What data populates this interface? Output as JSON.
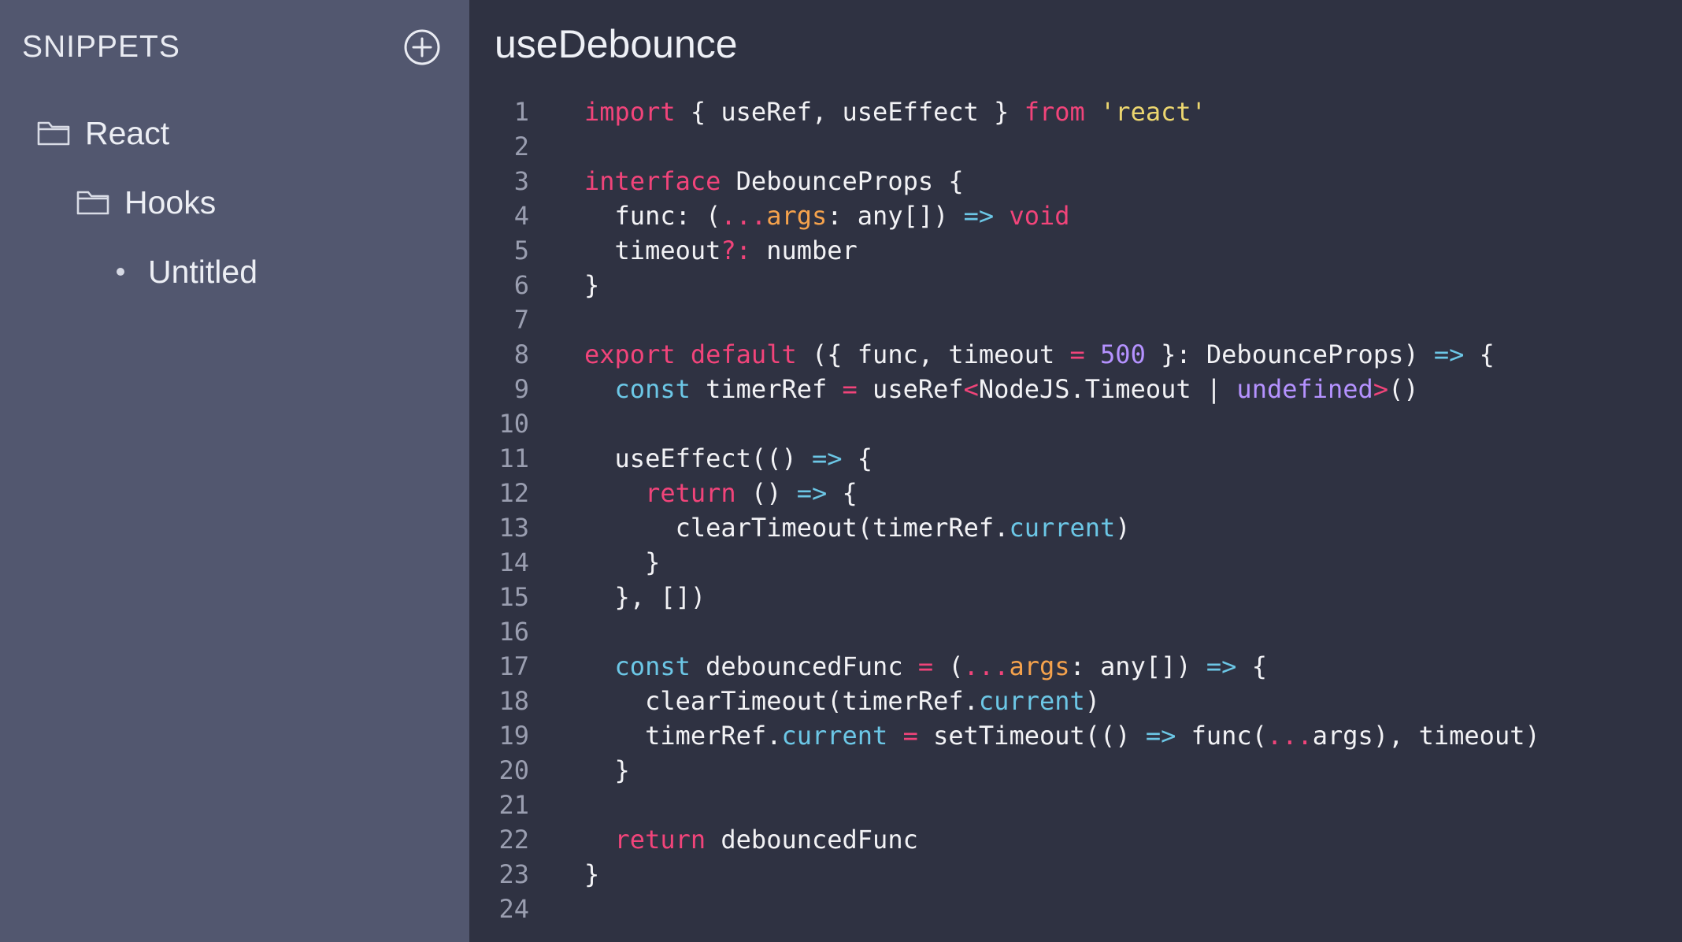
{
  "sidebar": {
    "title": "SNIPPETS",
    "add_icon": "plus-circle-icon",
    "items": [
      {
        "label": "React",
        "icon": "folder-icon",
        "level": 0
      },
      {
        "label": "Hooks",
        "icon": "folder-icon",
        "level": 1
      },
      {
        "label": "Untitled",
        "icon": "bullet-icon",
        "level": 2
      }
    ]
  },
  "editor": {
    "title": "useDebounce",
    "colors": {
      "keyword": "#f1447a",
      "string": "#ecd66f",
      "param": "#f5a24c",
      "arrow": "#6cc7e6",
      "number": "#b592ff",
      "text": "#f2f2f5",
      "line_number": "#9a9eb0"
    },
    "lines": [
      {
        "n": "1",
        "tokens": [
          [
            "kw",
            "import"
          ],
          [
            "plain",
            " { useRef, useEffect } "
          ],
          [
            "kw",
            "from"
          ],
          [
            "plain",
            " "
          ],
          [
            "str",
            "'react'"
          ]
        ]
      },
      {
        "n": "2",
        "tokens": []
      },
      {
        "n": "3",
        "tokens": [
          [
            "kw",
            "interface"
          ],
          [
            "plain",
            " DebounceProps {"
          ]
        ]
      },
      {
        "n": "4",
        "tokens": [
          [
            "plain",
            "  func: ("
          ],
          [
            "kw",
            "..."
          ],
          [
            "param",
            "args"
          ],
          [
            "plain",
            ": any[]) "
          ],
          [
            "blue",
            "=>"
          ],
          [
            "plain",
            " "
          ],
          [
            "kw",
            "void"
          ]
        ]
      },
      {
        "n": "5",
        "tokens": [
          [
            "plain",
            "  timeout"
          ],
          [
            "kw",
            "?:"
          ],
          [
            "plain",
            " number"
          ]
        ]
      },
      {
        "n": "6",
        "tokens": [
          [
            "plain",
            "}"
          ]
        ]
      },
      {
        "n": "7",
        "tokens": []
      },
      {
        "n": "8",
        "tokens": [
          [
            "kw",
            "export"
          ],
          [
            "plain",
            " "
          ],
          [
            "kw",
            "default"
          ],
          [
            "plain",
            " ({ func, timeout "
          ],
          [
            "kw",
            "="
          ],
          [
            "plain",
            " "
          ],
          [
            "num",
            "500"
          ],
          [
            "plain",
            " }: DebounceProps) "
          ],
          [
            "blue",
            "=>"
          ],
          [
            "plain",
            " {"
          ]
        ]
      },
      {
        "n": "9",
        "tokens": [
          [
            "plain",
            "  "
          ],
          [
            "blue",
            "const"
          ],
          [
            "plain",
            " timerRef "
          ],
          [
            "kw",
            "="
          ],
          [
            "plain",
            " useRef"
          ],
          [
            "kw",
            "<"
          ],
          [
            "plain",
            "NodeJS.Timeout | "
          ],
          [
            "purple",
            "undefined"
          ],
          [
            "kw",
            ">"
          ],
          [
            "plain",
            "()"
          ]
        ]
      },
      {
        "n": "10",
        "tokens": []
      },
      {
        "n": "11",
        "tokens": [
          [
            "plain",
            "  useEffect(() "
          ],
          [
            "blue",
            "=>"
          ],
          [
            "plain",
            " {"
          ]
        ]
      },
      {
        "n": "12",
        "tokens": [
          [
            "plain",
            "    "
          ],
          [
            "kw",
            "return"
          ],
          [
            "plain",
            " () "
          ],
          [
            "blue",
            "=>"
          ],
          [
            "plain",
            " {"
          ]
        ]
      },
      {
        "n": "13",
        "tokens": [
          [
            "plain",
            "      clearTimeout(timerRef."
          ],
          [
            "blue",
            "current"
          ],
          [
            "plain",
            ")"
          ]
        ]
      },
      {
        "n": "14",
        "tokens": [
          [
            "plain",
            "    }"
          ]
        ]
      },
      {
        "n": "15",
        "tokens": [
          [
            "plain",
            "  }, [])"
          ]
        ]
      },
      {
        "n": "16",
        "tokens": []
      },
      {
        "n": "17",
        "tokens": [
          [
            "plain",
            "  "
          ],
          [
            "blue",
            "const"
          ],
          [
            "plain",
            " debouncedFunc "
          ],
          [
            "kw",
            "="
          ],
          [
            "plain",
            " ("
          ],
          [
            "kw",
            "..."
          ],
          [
            "param",
            "args"
          ],
          [
            "plain",
            ": any[]) "
          ],
          [
            "blue",
            "=>"
          ],
          [
            "plain",
            " {"
          ]
        ]
      },
      {
        "n": "18",
        "tokens": [
          [
            "plain",
            "    clearTimeout(timerRef."
          ],
          [
            "blue",
            "current"
          ],
          [
            "plain",
            ")"
          ]
        ]
      },
      {
        "n": "19",
        "tokens": [
          [
            "plain",
            "    timerRef."
          ],
          [
            "blue",
            "current"
          ],
          [
            "plain",
            " "
          ],
          [
            "kw",
            "="
          ],
          [
            "plain",
            " setTimeout(() "
          ],
          [
            "blue",
            "=>"
          ],
          [
            "plain",
            " func("
          ],
          [
            "kw",
            "..."
          ],
          [
            "plain",
            "args), timeout)"
          ]
        ]
      },
      {
        "n": "20",
        "tokens": [
          [
            "plain",
            "  }"
          ]
        ]
      },
      {
        "n": "21",
        "tokens": []
      },
      {
        "n": "22",
        "tokens": [
          [
            "plain",
            "  "
          ],
          [
            "kw",
            "return"
          ],
          [
            "plain",
            " debouncedFunc"
          ]
        ]
      },
      {
        "n": "23",
        "tokens": [
          [
            "plain",
            "}"
          ]
        ]
      },
      {
        "n": "24",
        "tokens": []
      }
    ]
  }
}
